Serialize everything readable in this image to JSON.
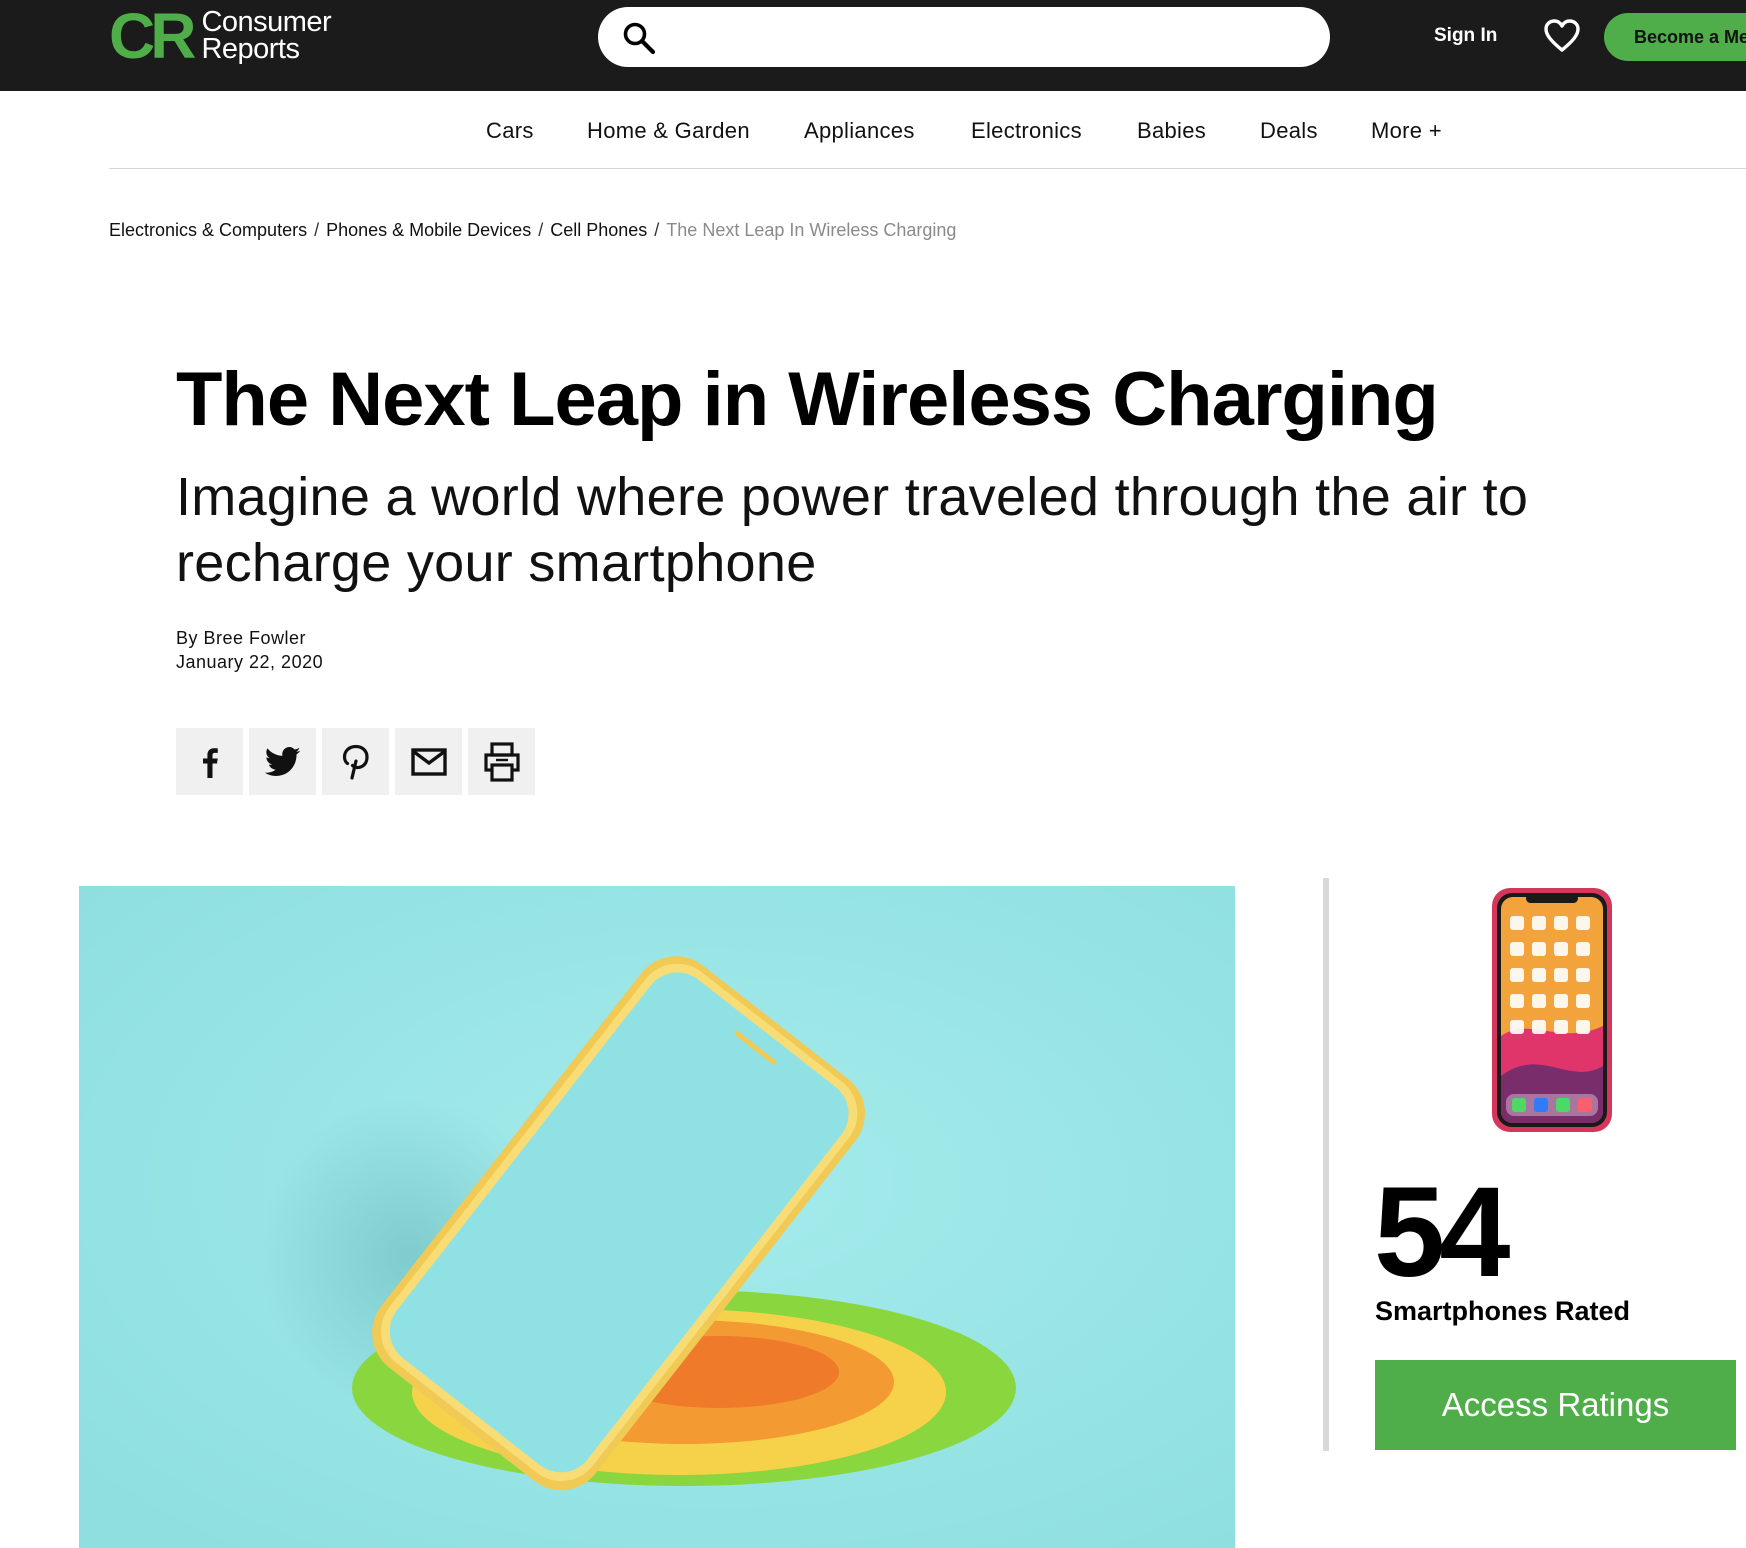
{
  "header": {
    "logo_mark": "CR",
    "logo_line1": "Consumer",
    "logo_line2": "Reports",
    "search_placeholder": "",
    "sign_in": "Sign In",
    "become_member": "Become a Member",
    "icons": {
      "search": "search-icon",
      "favorites": "heart-icon"
    },
    "brand_color": "#4fae4a",
    "bar_color": "#1b1b1b"
  },
  "nav": {
    "items": [
      "Cars",
      "Home & Garden",
      "Appliances",
      "Electronics",
      "Babies",
      "Deals",
      "More +"
    ]
  },
  "breadcrumb": {
    "items": [
      "Electronics & Computers",
      "Phones & Mobile Devices",
      "Cell Phones"
    ],
    "current": "The Next Leap In Wireless Charging",
    "separator": "/"
  },
  "article": {
    "title": "The Next Leap in Wireless Charging",
    "dek": "Imagine a world where power traveled through the air to recharge your smartphone",
    "author": "By Bree Fowler",
    "date": "January 22, 2020",
    "share_icons": [
      "facebook-icon",
      "twitter-icon",
      "pinterest-icon",
      "email-icon",
      "print-icon"
    ],
    "hero_bg_color": "#97e3e4"
  },
  "sidebar": {
    "count": "54",
    "count_label": "Smartphones Rated",
    "cta": "Access Ratings",
    "cta_color": "#4fae4a"
  }
}
